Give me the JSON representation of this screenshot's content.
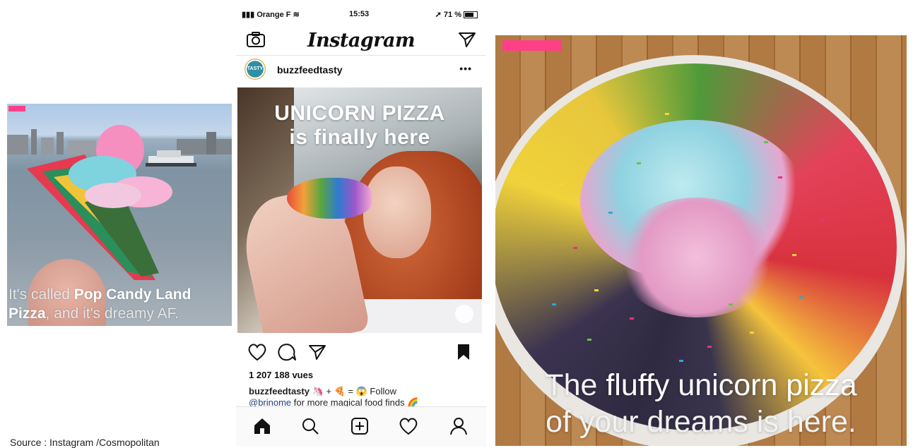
{
  "left_post": {
    "caption_pre": "It's called ",
    "caption_bold": "Pop Candy Land Pizza",
    "caption_post": ", and it's dreamy AF."
  },
  "phone": {
    "status": {
      "carrier": "Orange F",
      "time": "15:53",
      "battery": "71 %"
    },
    "app_title": "Instagram",
    "username": "buzzfeedtasty",
    "avatar_text": "TASTY",
    "more": "•••",
    "post_headline_1": "UNICORN PIZZA",
    "post_headline_2": "is finally here",
    "views": "1 207 188 vues",
    "caption_user": "buzzfeedtasty",
    "caption_text": "🦄 + 🍕 = 😱 Follow",
    "caption_mention": "@brinome",
    "caption_rest": " for more magical food finds 🌈"
  },
  "right_post": {
    "caption_pre": "The ",
    "caption_bold": "fluffy unicorn pizza",
    "caption_line2": "of your dreams is here."
  },
  "source": "Source : Instagram /Cosmopolitan",
  "colors": {
    "brand_pink": "#ff3f87",
    "mention_blue": "#223f80"
  },
  "icons": [
    "camera-icon",
    "direct-send-icon",
    "like-heart-icon",
    "comment-icon",
    "share-icon",
    "bookmark-icon",
    "home-icon",
    "search-icon",
    "new-post-icon",
    "activity-heart-icon",
    "profile-icon"
  ]
}
